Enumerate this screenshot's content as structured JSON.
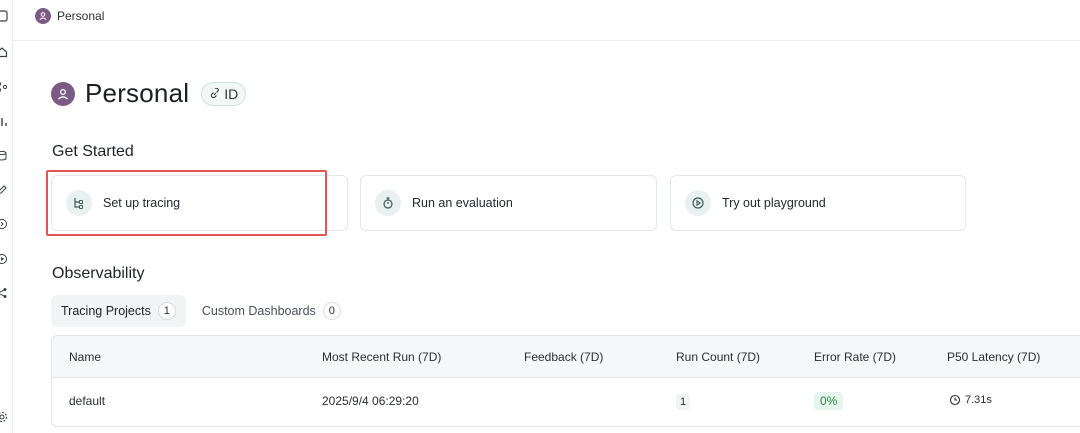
{
  "breadcrumb": {
    "label": "Personal"
  },
  "workspace": {
    "title": "Personal",
    "id_badge": "ID"
  },
  "get_started": {
    "title": "Get Started",
    "cards": [
      {
        "label": "Set up tracing",
        "icon": "tracing-icon"
      },
      {
        "label": "Run an evaluation",
        "icon": "stopwatch-icon"
      },
      {
        "label": "Try out playground",
        "icon": "play-icon"
      }
    ]
  },
  "observability": {
    "title": "Observability",
    "tabs": [
      {
        "label": "Tracing Projects",
        "count": "1",
        "active": true
      },
      {
        "label": "Custom Dashboards",
        "count": "0",
        "active": false
      }
    ],
    "columns": [
      "Name",
      "Most Recent Run (7D)",
      "Feedback (7D)",
      "Run Count (7D)",
      "Error Rate (7D)",
      "P50 Latency (7D)"
    ],
    "rows": [
      {
        "name": "default",
        "recent_run": "2025/9/4 06:29:20",
        "feedback": "",
        "run_count": "1",
        "error_rate": "0%",
        "p50_latency": "7.31s"
      }
    ]
  },
  "colors": {
    "accent": "#e25555",
    "avatar": "#7b5a86",
    "success": "#1f8a45"
  }
}
